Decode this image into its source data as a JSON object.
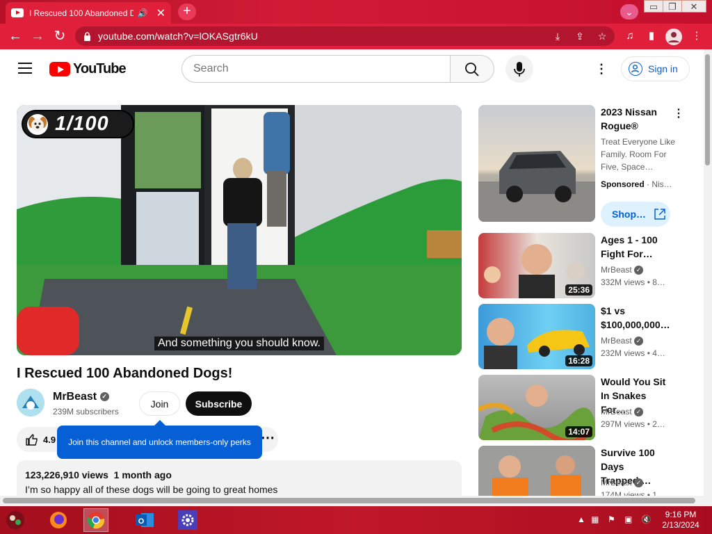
{
  "browser": {
    "tab_title": "I Rescued 100 Abandoned D",
    "url": "youtube.com/watch?v=lOKASgtr6kU",
    "window_controls": [
      "▭",
      "❐",
      "✕"
    ]
  },
  "header": {
    "logo_text": "YouTube",
    "search_placeholder": "Search",
    "signin_label": "Sign in"
  },
  "video": {
    "counter": "1/100",
    "caption": "And something you should know.",
    "title": "I Rescued 100 Abandoned Dogs!",
    "channel": "MrBeast",
    "subscribers": "239M subscribers",
    "join_label": "Join",
    "subscribe_label": "Subscribe",
    "likes": "4.9",
    "tooltip": "Join this channel and unlock members-only perks",
    "views": "123,226,910 views",
    "age": "1 month ago",
    "description": "I’m so happy all of these dogs will be going to great homes"
  },
  "sidebar": {
    "ad": {
      "title": "2023 Nissan Rogue®",
      "description": "Treat Everyone Like Family. Room For Five, Space…",
      "sponsored": "Sponsored",
      "advertiser": "Nis…",
      "cta": "Shop…"
    },
    "videos": [
      {
        "title": "Ages 1 - 100\nFight For…",
        "channel": "MrBeast",
        "meta": "332M views  •  8…",
        "duration": "25:36"
      },
      {
        "title": "$1 vs\n$100,000,000…",
        "channel": "MrBeast",
        "meta": "232M views  •  4…",
        "duration": "16:28"
      },
      {
        "title": "Would You Sit\nIn Snakes For…",
        "channel": "MrBeast",
        "meta": "297M views  •  2…",
        "duration": "14:07"
      },
      {
        "title": "Survive 100\nDays Trapped,…",
        "channel": "MrBeast",
        "meta": "174M views  •  1…",
        "duration": ""
      }
    ]
  },
  "taskbar": {
    "time": "9:16 PM",
    "date": "2/13/2024"
  },
  "colors": {
    "browser_red": "#e01f3a",
    "yt_red": "#ff0000",
    "link_blue": "#065fd4"
  }
}
